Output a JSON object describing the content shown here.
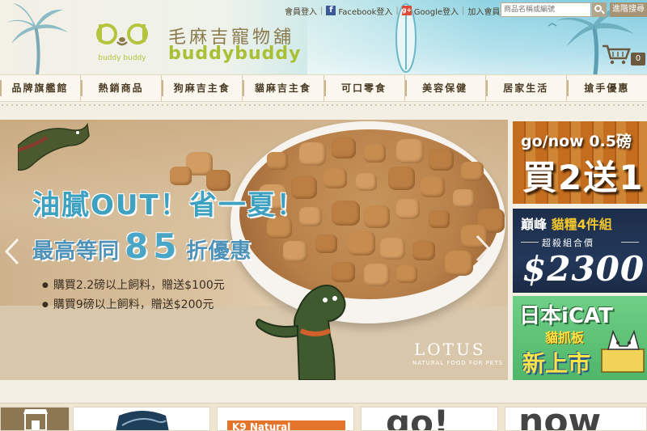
{
  "header": {
    "logo_cn": "毛麻吉寵物舖",
    "logo_en": "buddybuddy",
    "logo_mark_text": "buddy buddy",
    "links": {
      "login": "會員登入",
      "facebook": "Facebook登入",
      "google": "Google登入",
      "join": "加入會員"
    },
    "search": {
      "placeholder": "商品名稱或編號",
      "advanced_label": "進階搜尋"
    },
    "cart_count": "0"
  },
  "nav": {
    "items": [
      "品牌旗艦館",
      "熱銷商品",
      "狗麻吉主食",
      "貓麻吉主食",
      "可口零食",
      "美容保健",
      "居家生活",
      "搶手優惠"
    ]
  },
  "banner": {
    "headline": "油膩OUT！省一夏！",
    "sub_prefix": "最高等同",
    "sub_number": "85",
    "sub_suffix": "折優惠",
    "bullets": [
      "購買2.2磅以上飼料，贈送$100元",
      "購買9磅以上飼料，贈送$200元"
    ],
    "brand_logo": "LOTUS",
    "brand_tagline": "NATURAL FOOD FOR PETS"
  },
  "side_ads": {
    "ad1": {
      "title": "go/now 0.5磅",
      "big": "買2送1"
    },
    "ad2": {
      "title_white": "巔峰",
      "title_yellow": "貓糧4件組",
      "sub": "超殺組合價",
      "price": "$2300"
    },
    "ad3": {
      "title": "日本iCAT",
      "mid": "貓抓板",
      "big": "新上市"
    }
  },
  "brand_strip": {
    "b3": "K9 Natural",
    "b4": "go!",
    "b5": "now"
  },
  "colors": {
    "nav_text": "#4a3b24",
    "headline_blue": "#3fa1c0",
    "logo_green": "#a9c036",
    "ad1_orange": "#e07e22",
    "ad2_navy": "#1d2e4a",
    "ad3_green": "#4fb66a"
  }
}
